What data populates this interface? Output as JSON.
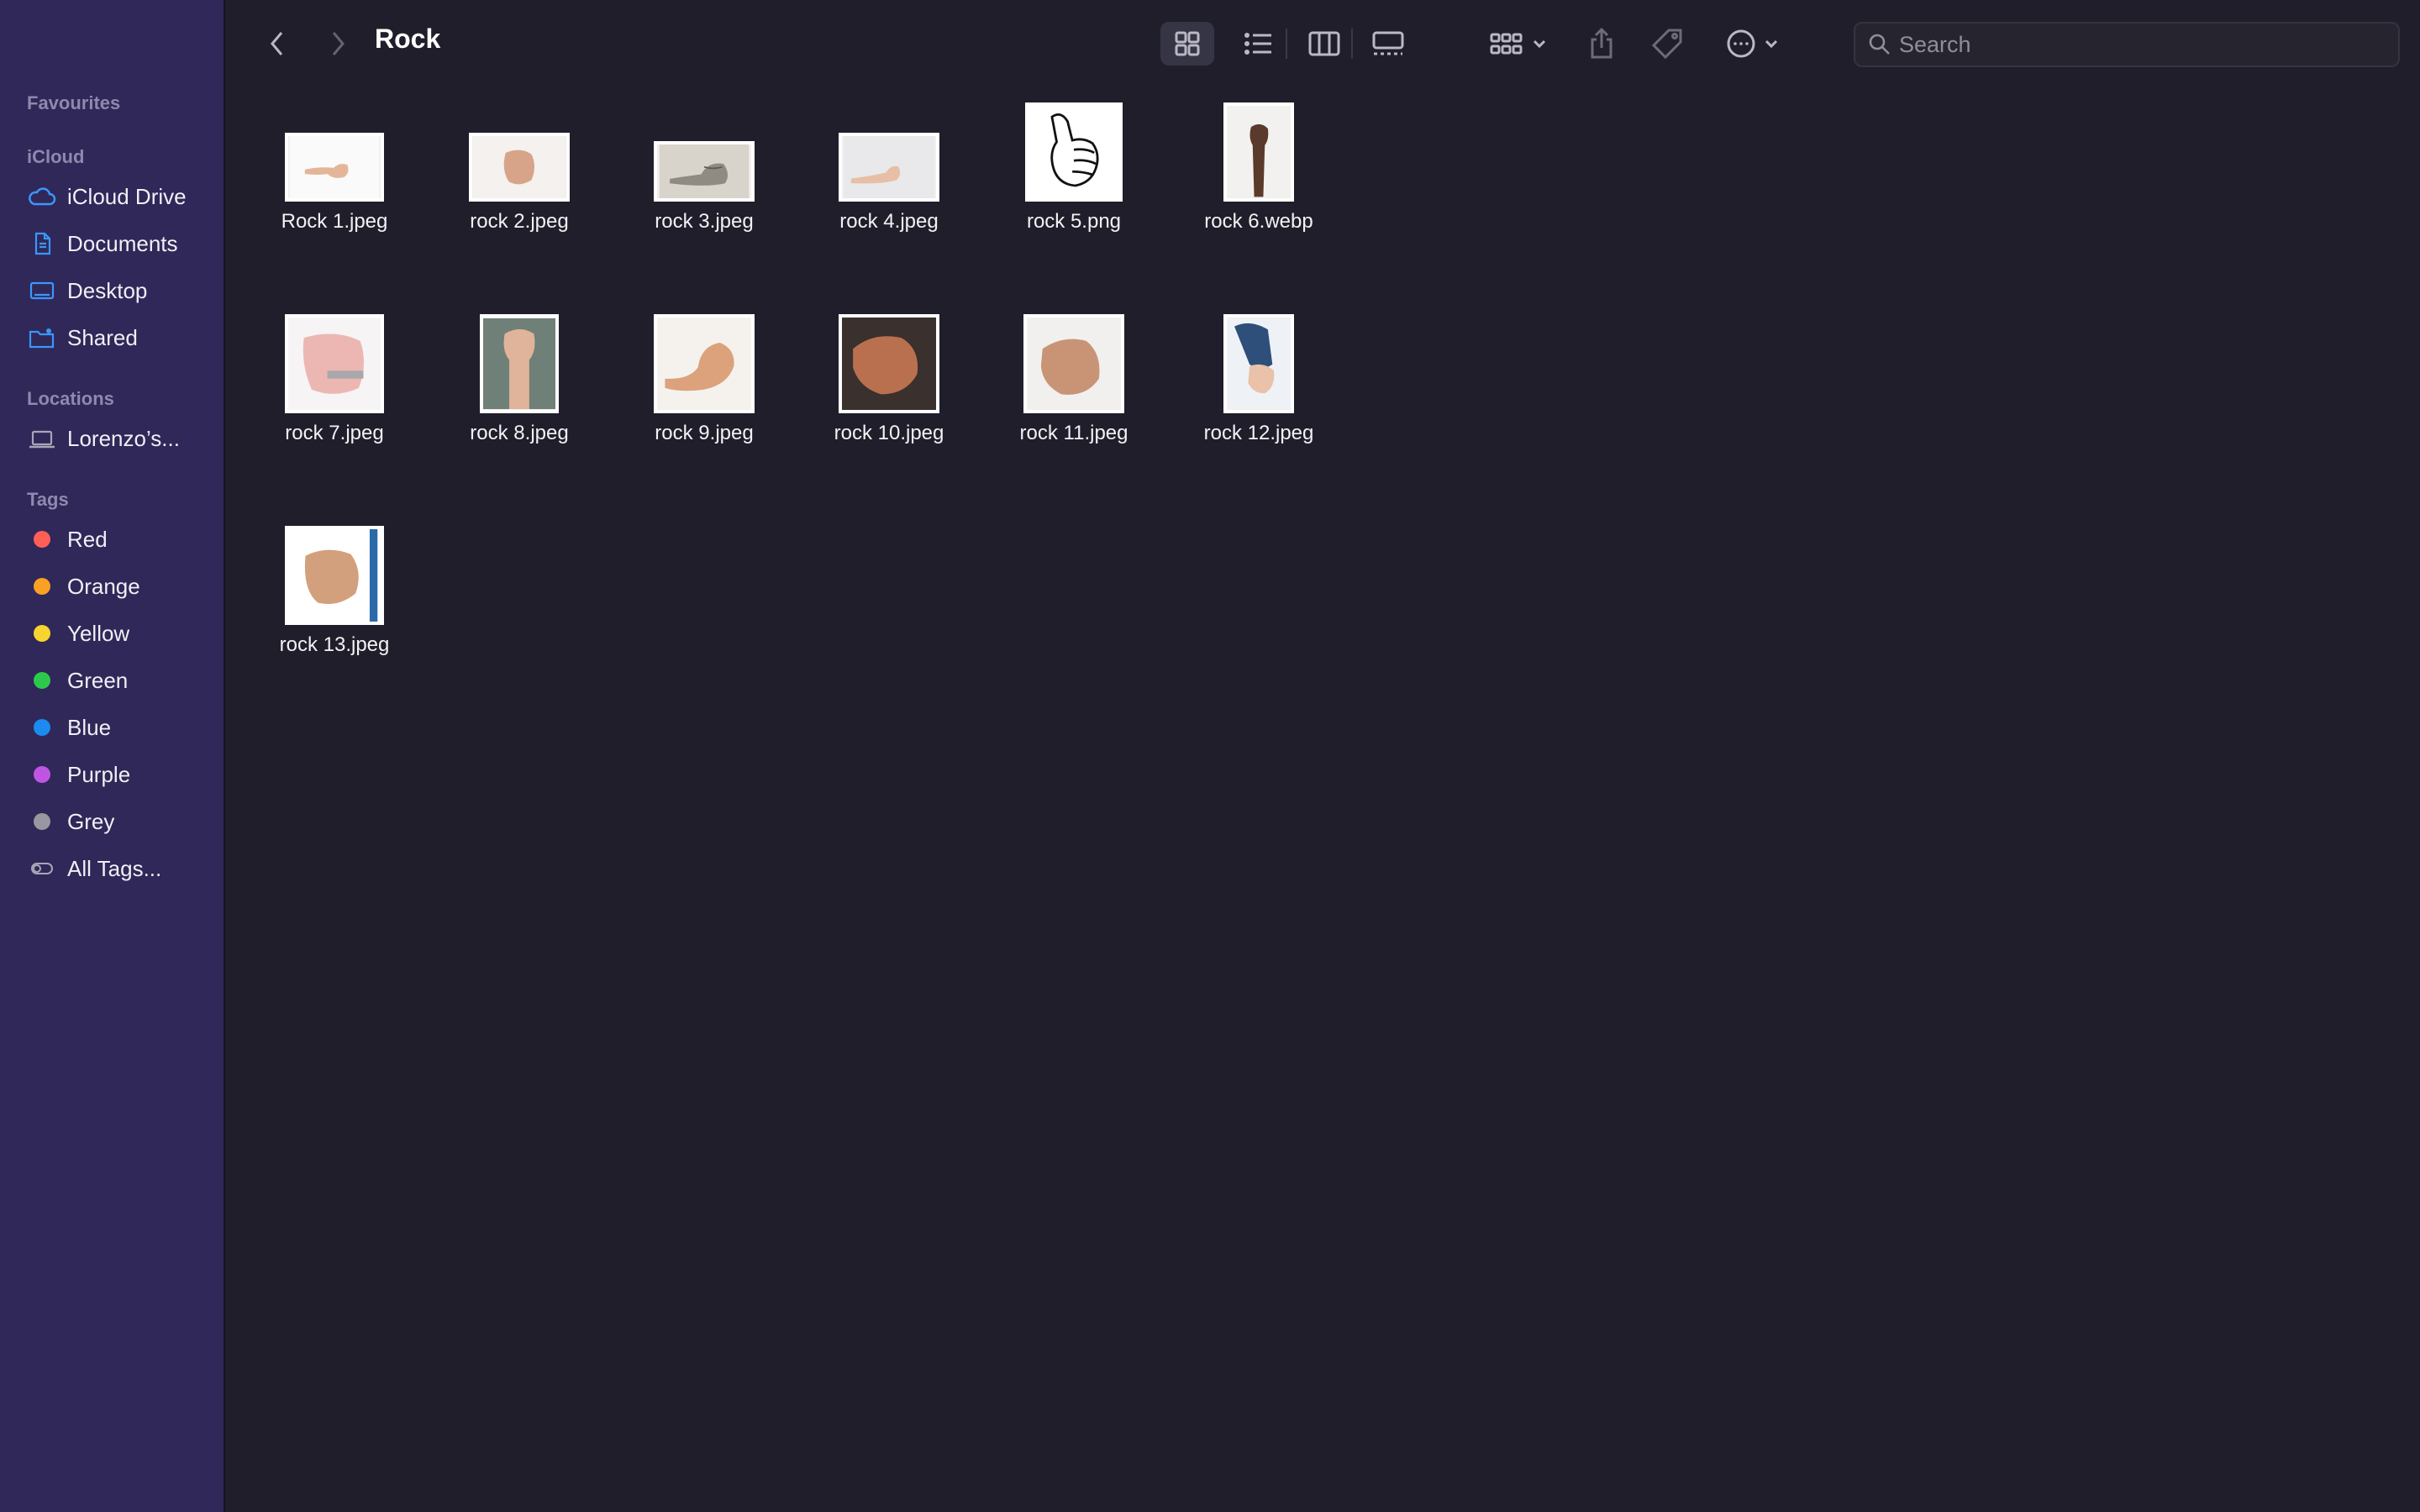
{
  "window": {
    "title": "Rock"
  },
  "sidebar": {
    "sections": [
      {
        "heading": "Favourites",
        "items": []
      },
      {
        "heading": "iCloud",
        "items": [
          {
            "label": "iCloud Drive",
            "icon": "cloud-icon"
          },
          {
            "label": "Documents",
            "icon": "document-icon"
          },
          {
            "label": "Desktop",
            "icon": "desktop-icon"
          },
          {
            "label": "Shared",
            "icon": "shared-folder-icon"
          }
        ]
      },
      {
        "heading": "Locations",
        "items": [
          {
            "label": "Lorenzo’s...",
            "icon": "laptop-icon"
          }
        ]
      },
      {
        "heading": "Tags",
        "items": []
      }
    ],
    "tags": [
      {
        "label": "Red",
        "color": "#fe5f57"
      },
      {
        "label": "Orange",
        "color": "#f9a025"
      },
      {
        "label": "Yellow",
        "color": "#f7d52e"
      },
      {
        "label": "Green",
        "color": "#2dc94d"
      },
      {
        "label": "Blue",
        "color": "#1d8af2"
      },
      {
        "label": "Purple",
        "color": "#c155e3"
      },
      {
        "label": "Grey",
        "color": "#98979f"
      }
    ],
    "all_tags": {
      "label": "All Tags...",
      "icon": "all-tags-icon"
    }
  },
  "toolbar": {
    "back": "chevron-left-icon",
    "forward": "chevron-right-icon",
    "views": [
      "icon-view-icon",
      "list-view-icon",
      "column-view-icon",
      "gallery-view-icon"
    ],
    "active_view": "icon-view-icon",
    "group": "group-by-icon",
    "share": "share-icon",
    "tag": "tag-icon",
    "more": "more-icon"
  },
  "search": {
    "placeholder": "Search",
    "value": ""
  },
  "files": [
    {
      "name": "Rock 1.jpeg"
    },
    {
      "name": "rock 2.jpeg"
    },
    {
      "name": "rock 3.jpeg"
    },
    {
      "name": "rock 4.jpeg"
    },
    {
      "name": "rock 5.png"
    },
    {
      "name": "rock 6.webp"
    },
    {
      "name": "rock 7.jpeg"
    },
    {
      "name": "rock 8.jpeg"
    },
    {
      "name": "rock 9.jpeg"
    },
    {
      "name": "rock 10.jpeg"
    },
    {
      "name": "rock 11.jpeg"
    },
    {
      "name": "rock 12.jpeg"
    },
    {
      "name": "rock 13.jpeg"
    }
  ]
}
